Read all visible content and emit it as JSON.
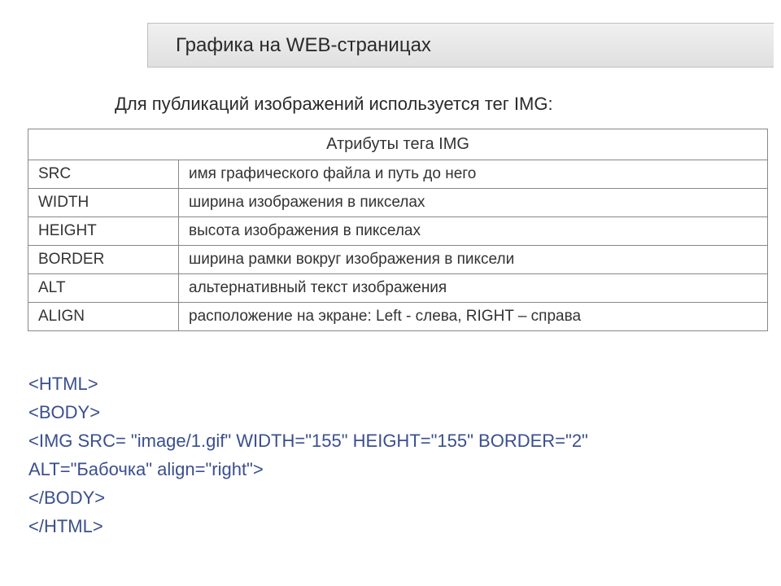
{
  "title": "Графика на WEB-страницах",
  "intro": "Для публикаций изображений используется тег IMG:",
  "table": {
    "header": "Атрибуты тега IMG",
    "rows": [
      {
        "attr": "SRC",
        "desc": "имя графического файла и путь до него"
      },
      {
        "attr": "WIDTH",
        "desc": "ширина изображения в пикселах"
      },
      {
        "attr": "HEIGHT",
        "desc": "высота изображения в пикселах"
      },
      {
        "attr": "BORDER",
        "desc": "ширина рамки вокруг изображения в пиксели"
      },
      {
        "attr": "ALT",
        "desc": "альтернативный текст изображения"
      },
      {
        "attr": "ALIGN",
        "desc": "расположение на экране: Left - слева, RIGHT – справа"
      }
    ]
  },
  "code": {
    "line1": "<HTML>",
    "line2": "<BODY>",
    "line3": "<IMG SRC= \"image/1.gif\" WIDTH=\"155\" HEIGHT=\"155\" BORDER=\"2\"",
    "line4": "ALT=\"Бабочка\" align=\"right\">",
    "line5": "</BODY>",
    "line6": "</HTML>"
  }
}
